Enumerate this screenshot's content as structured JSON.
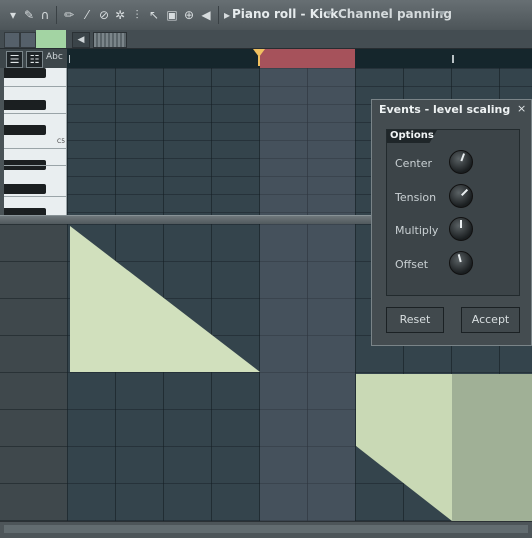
{
  "toolbar": {
    "title": "Piano roll - Kick",
    "target": "Channel panning",
    "icons": [
      "dropdown-arrow-icon",
      "wrench-icon",
      "magnet-icon",
      "pencil-icon",
      "brush-icon",
      "delete-icon",
      "mute-icon",
      "slice-icon",
      "select-icon",
      "zoom-icon",
      "speaker-icon"
    ]
  },
  "keyboard": {
    "octave_label": "C5"
  },
  "header": {
    "abc_label": "Abc"
  },
  "dialog": {
    "title": "Events - level scaling",
    "close": "×",
    "options_label": "Options",
    "knobs": [
      {
        "label": "Center"
      },
      {
        "label": "Tension"
      },
      {
        "label": "Multiply"
      },
      {
        "label": "Offset"
      }
    ],
    "reset_label": "Reset",
    "accept_label": "Accept"
  },
  "colors": {
    "loop_region": "#a6525b",
    "event_fill": "#d1e0bd",
    "channel_color": "#a3d4a3"
  }
}
